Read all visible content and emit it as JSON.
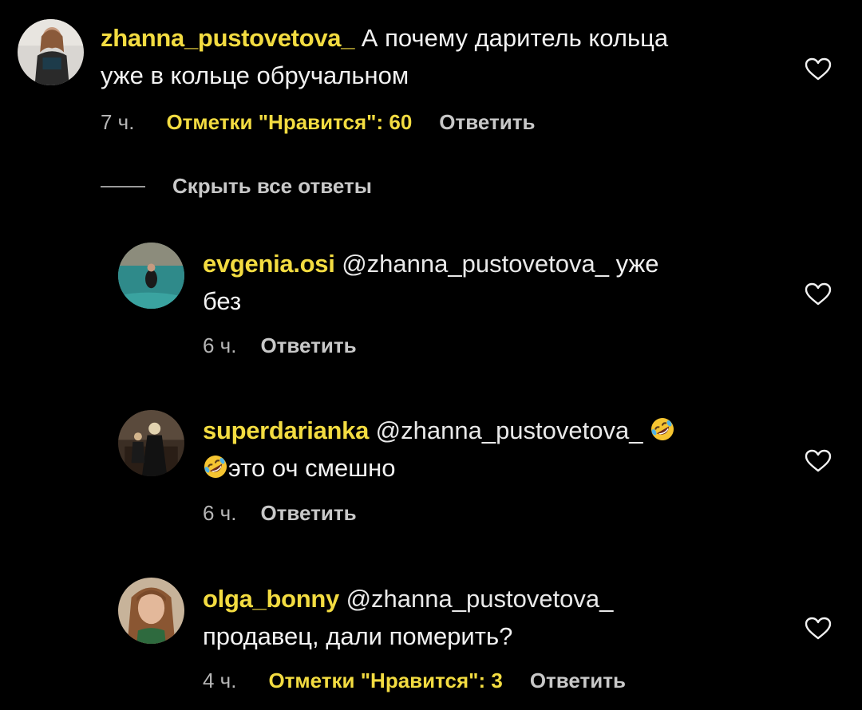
{
  "comments": [
    {
      "username": "zhanna_pustovetova_",
      "line1": "А почему даритель кольца",
      "line2": "уже в кольце обручальном",
      "time": "7 ч.",
      "likes": "Отметки \"Нравится\": 60",
      "reply": "Ответить"
    }
  ],
  "hide_replies": "Скрыть все ответы",
  "replies": [
    {
      "username": "evgenia.osi",
      "mention": "@zhanna_pustovetova_",
      "text_after_mention": "уже",
      "line2": "без",
      "time": "6 ч.",
      "reply": "Ответить"
    },
    {
      "username": "superdarianka",
      "mention": "@zhanna_pustovetova_",
      "line2": "это оч смешно",
      "time": "6 ч.",
      "reply": "Ответить",
      "emoji": "rolling-on-floor-laughing"
    },
    {
      "username": "olga_bonny",
      "mention": "@zhanna_pustovetova_",
      "line2": "продавец, дали померить?",
      "time": "4 ч.",
      "likes": "Отметки \"Нравится\": 3",
      "reply": "Ответить"
    }
  ],
  "colors": {
    "background": "#000000",
    "username": "#f3dc41",
    "text": "#f2f2f2",
    "meta": "#b5b5b5"
  },
  "icons": {
    "like": "heart-outline-icon"
  }
}
